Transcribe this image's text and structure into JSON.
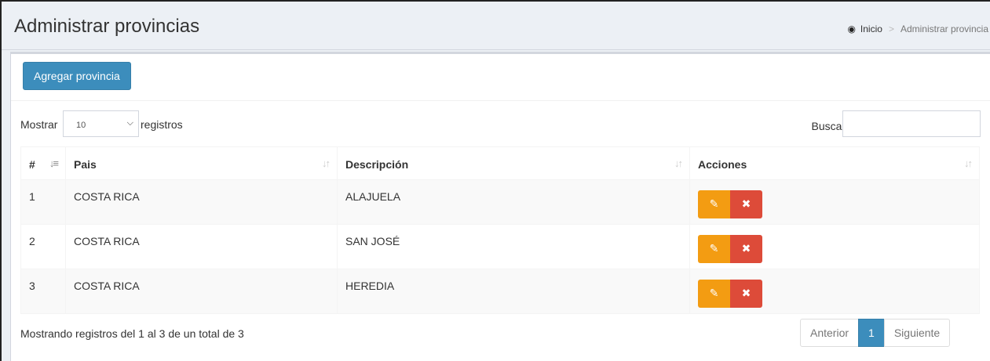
{
  "header": {
    "title": "Administrar provincias",
    "breadcrumb": {
      "home_icon": "dashboard-icon",
      "home": "Inicio",
      "current": "Administrar provincia"
    }
  },
  "toolbar": {
    "add_label": "Agregar provincia"
  },
  "length_control": {
    "prefix": "Mostrar",
    "value": "10",
    "suffix": "registros"
  },
  "search": {
    "label": "Buscar:",
    "value": ""
  },
  "table": {
    "columns": [
      "#",
      "Pais",
      "Descripción",
      "Acciones"
    ],
    "rows": [
      {
        "num": "1",
        "pais": "COSTA RICA",
        "descripcion": "ALAJUELA"
      },
      {
        "num": "2",
        "pais": "COSTA RICA",
        "descripcion": "SAN JOSÉ"
      },
      {
        "num": "3",
        "pais": "COSTA RICA",
        "descripcion": "HEREDIA"
      }
    ],
    "action_icons": [
      "pencil-icon",
      "close-icon"
    ]
  },
  "footer": {
    "info": "Mostrando registros del 1 al 3 de un total de 3",
    "pagination": {
      "prev": "Anterior",
      "current": "1",
      "next": "Siguiente"
    }
  },
  "colors": {
    "primary": "#3c8dbc",
    "warning": "#f39c12",
    "danger": "#dd4b39"
  }
}
